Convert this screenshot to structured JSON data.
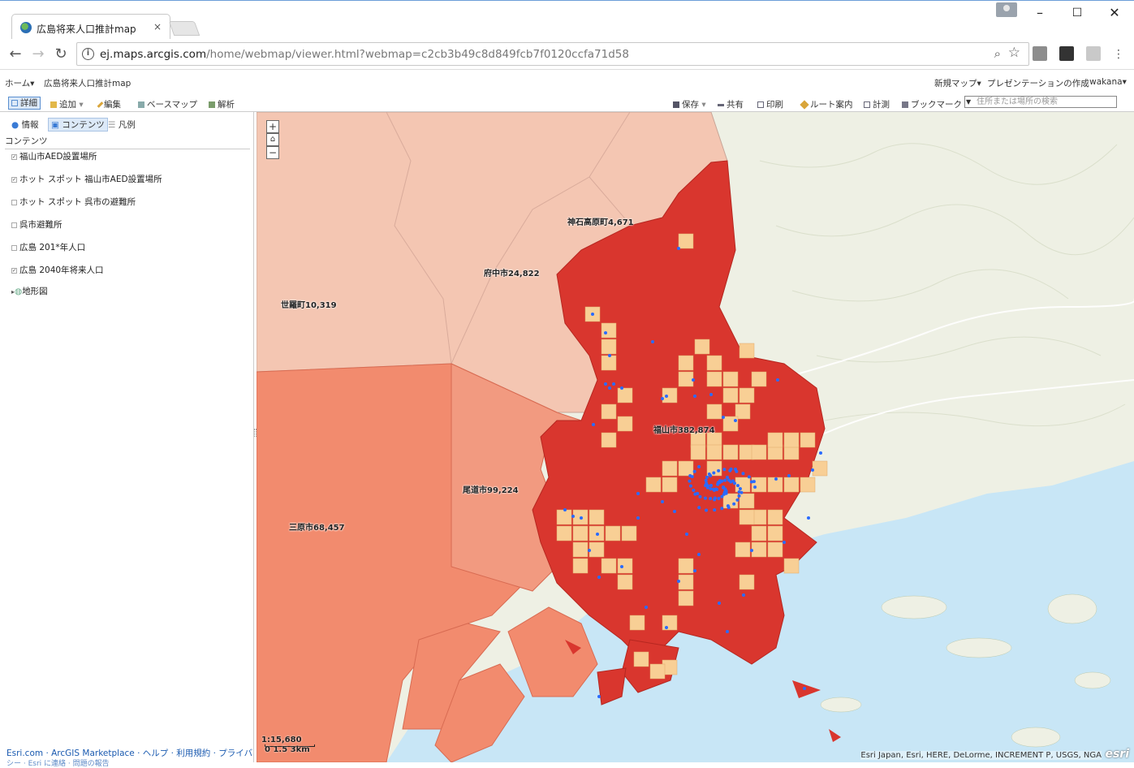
{
  "browser": {
    "tab_title": "広島将来人口推計map",
    "tab_close": "×",
    "url_host": "ej.maps.arcgis.com",
    "url_path": "/home/webmap/viewer.html?webmap=c2cb3b49c8d849fcb7f0120ccfa71d58",
    "window_controls": [
      "–",
      "☐",
      "✕"
    ]
  },
  "header": {
    "home_label": "ホーム▾",
    "map_title": "広島将来人口推計map",
    "new_map": "新規マップ▾",
    "create_presentation": "プレゼンテーションの作成",
    "user": "wakana▾"
  },
  "tools": {
    "details": "詳細",
    "add": "追加",
    "add_caret": "▾",
    "edit": "編集",
    "basemap": "ベースマップ",
    "analysis": "解析",
    "save": "保存",
    "save_caret": "▾",
    "share": "共有",
    "print": "印刷",
    "directions": "ルート案内",
    "measure": "計測",
    "bookmarks": "ブックマーク",
    "search_placeholder": "住所または場所の検索"
  },
  "panel": {
    "tabs": [
      "情報",
      "コンテンツ",
      "凡例"
    ],
    "title": "コンテンツ",
    "layers": [
      {
        "label": "福山市AED設置場所",
        "checked": true
      },
      {
        "label": "ホット スポット 福山市AED設置場所",
        "checked": true
      },
      {
        "label": "ホット スポット 呉市の避難所",
        "checked": false
      },
      {
        "label": "呉市避難所",
        "checked": false
      },
      {
        "label": "広島 201*年人口",
        "checked": false
      },
      {
        "label": "広島 2040年将来人口",
        "checked": true
      }
    ],
    "basemap_layer": "地形図",
    "footer": "Esri.com · ArcGIS Marketplace · ヘルプ · 利用規約 · プライバ",
    "footer2": "シー · Esri に連絡 · 問題の報告"
  },
  "map": {
    "labels": [
      {
        "text": "神石高原町4,671"
      },
      {
        "text": "府中市24,822"
      },
      {
        "text": "世羅町10,319"
      },
      {
        "text": "福山市382,874"
      },
      {
        "text": "尾道市99,224"
      },
      {
        "text": "三原市68,457"
      }
    ],
    "scale_ratio": "1:15,680",
    "scale_ticks": "0    1.5  3km",
    "attribution": "Esri Japan, Esri, HERE, DeLorme, INCREMENT P, USGS, NGA",
    "esri_logo": "esri",
    "zoom_in": "+",
    "home": "⌂",
    "zoom_out": "−",
    "colors": {
      "fukuyama": "#d9362e",
      "onomichi": "#f28b6e",
      "fuchu": "#f4c6b2",
      "grid_cell": "#f8cf95",
      "aed_point": "#2a6bff",
      "sea": "#c8e6f6"
    }
  }
}
